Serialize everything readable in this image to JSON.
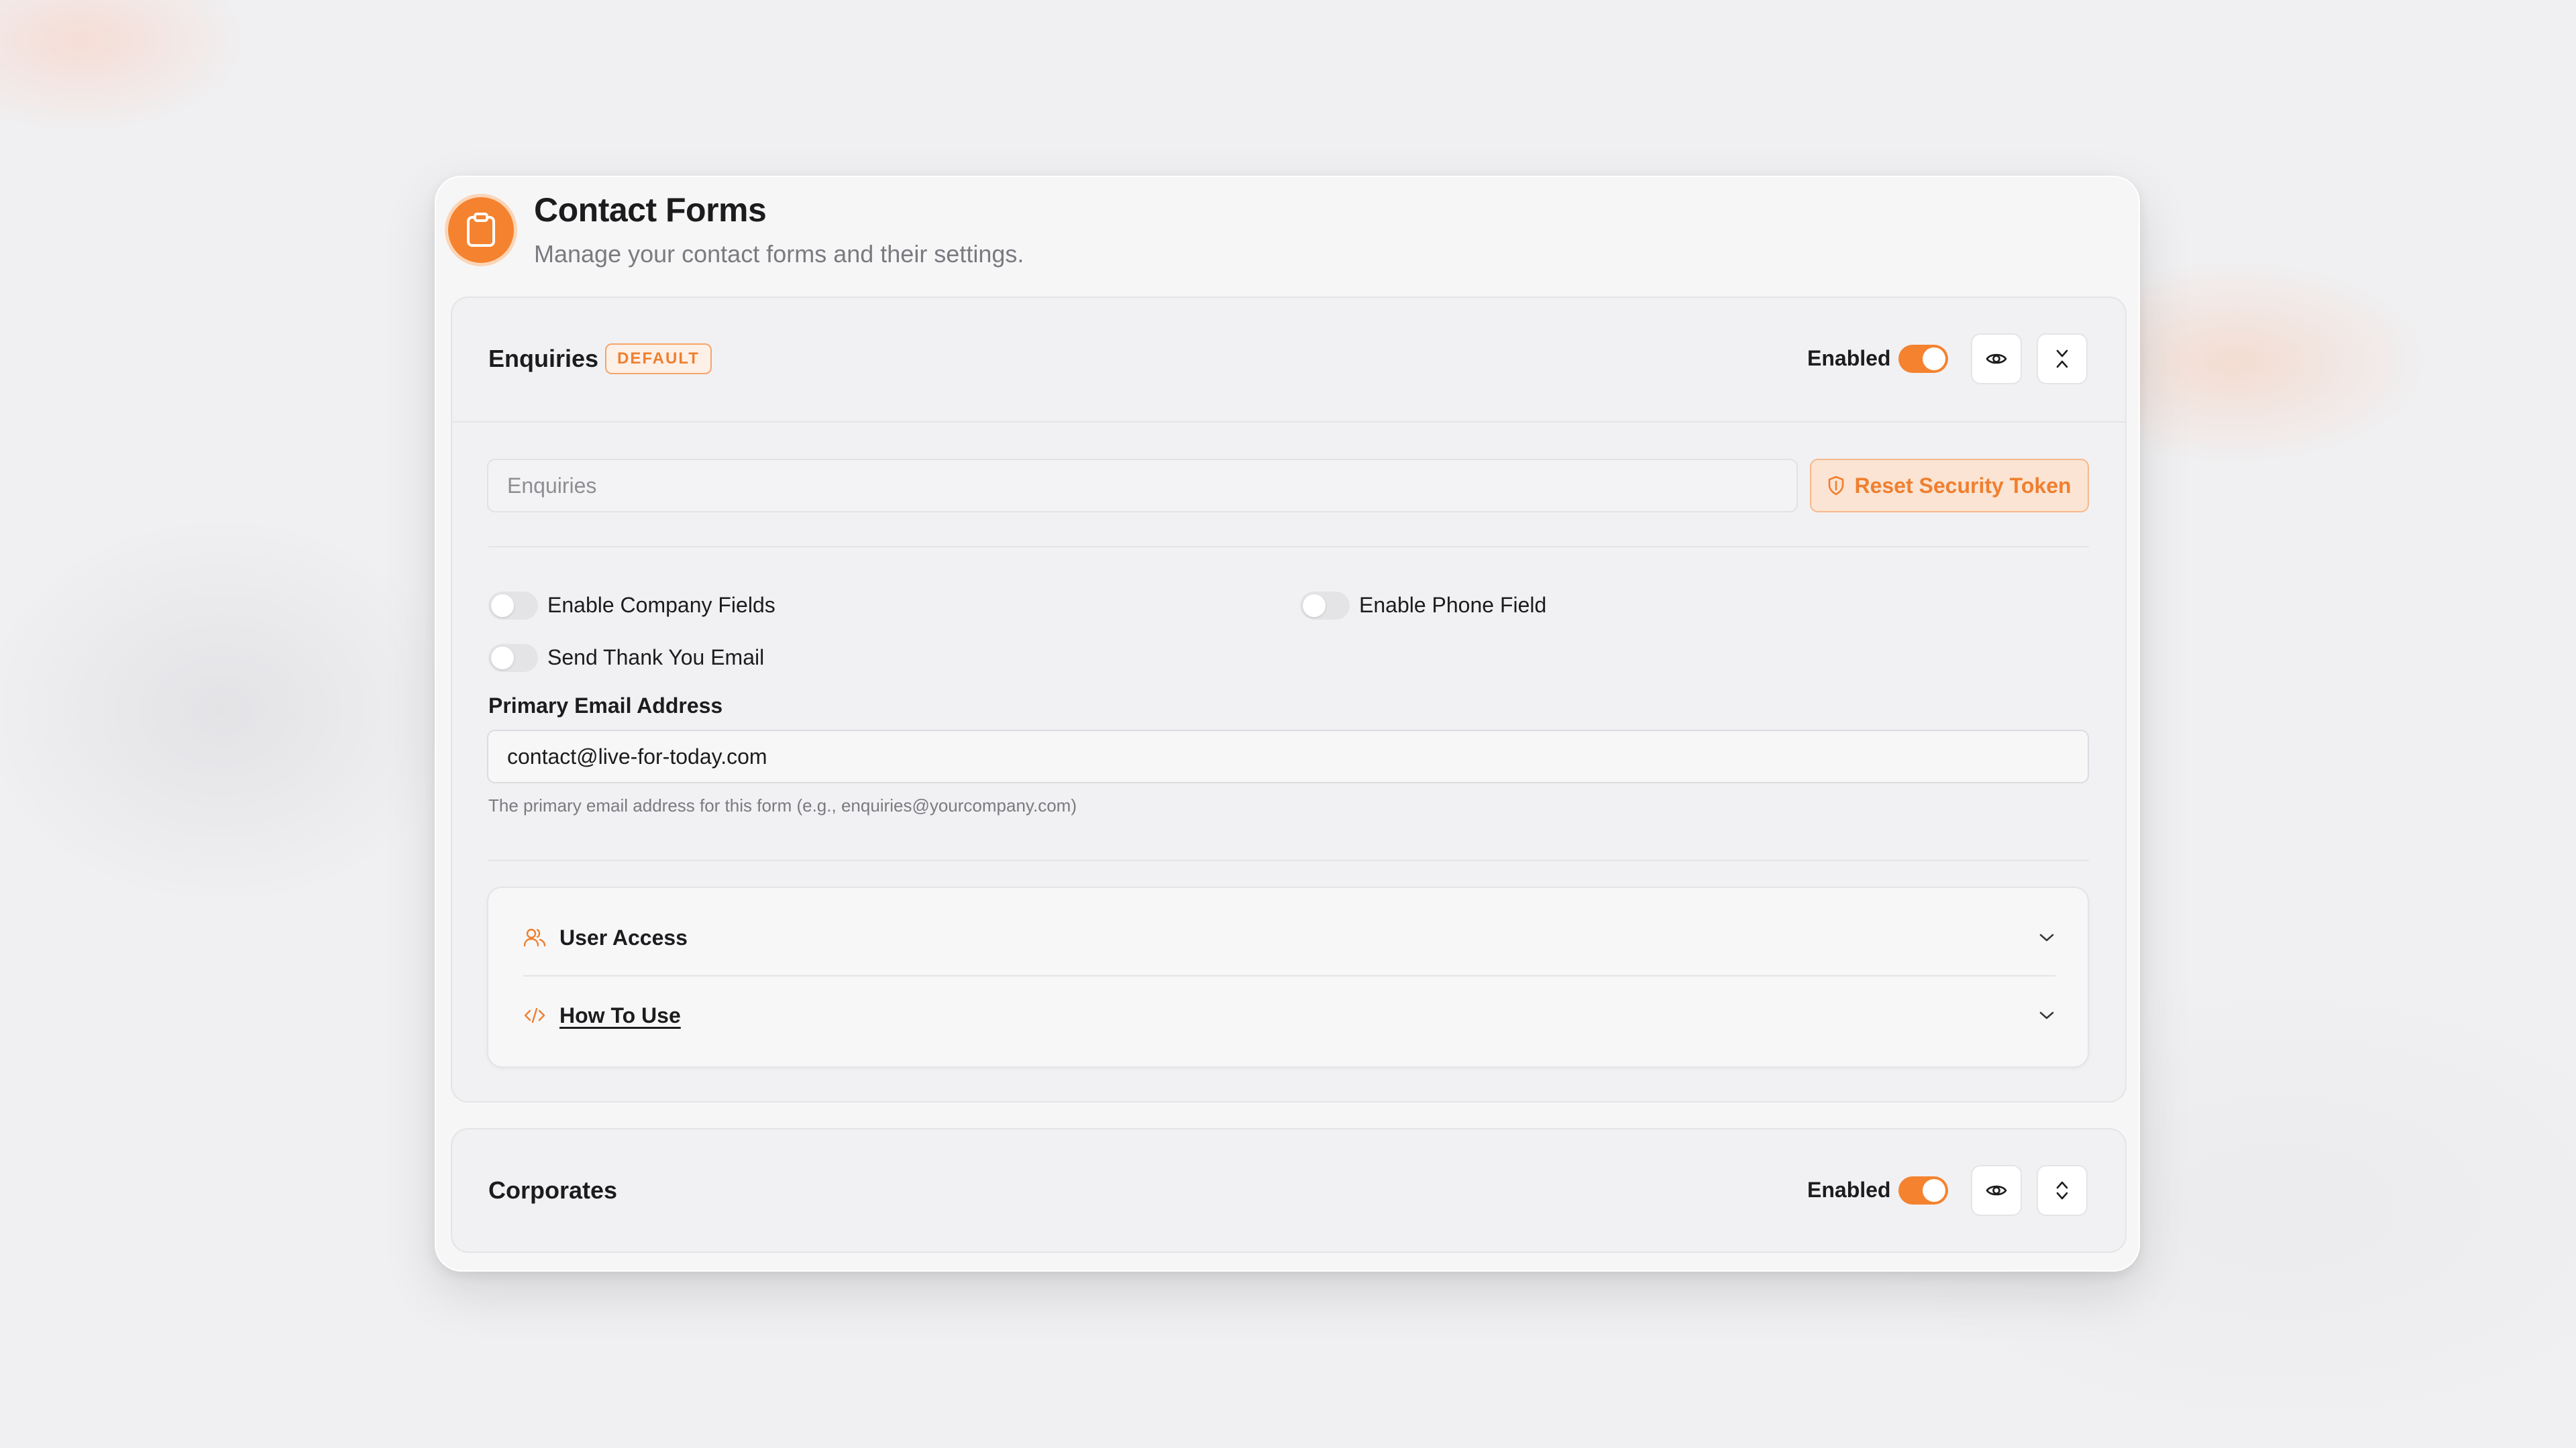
{
  "page": {
    "title": "Contact Forms",
    "subtitle": "Manage your contact forms and their settings.",
    "logo_icon": "clipboard-icon",
    "accent_color": "#f5822e"
  },
  "forms": [
    {
      "name": "Enquiries",
      "badge": "DEFAULT",
      "enabled_label": "Enabled",
      "enabled": true,
      "expanded": true,
      "name_placeholder": "Enquiries",
      "reset_token_label": "Reset Security Token",
      "options": {
        "company_fields": {
          "label": "Enable Company Fields",
          "on": false
        },
        "phone_field": {
          "label": "Enable Phone Field",
          "on": false
        },
        "thank_you_email": {
          "label": "Send Thank You Email",
          "on": false
        }
      },
      "primary_email": {
        "label": "Primary Email Address",
        "value": "contact@live-for-today.com",
        "helper": "The primary email address for this form (e.g., enquiries@yourcompany.com)"
      },
      "sections": [
        {
          "label": "User Access",
          "icon": "users-icon"
        },
        {
          "label": "How To Use",
          "icon": "code-icon"
        }
      ]
    },
    {
      "name": "Corporates",
      "enabled_label": "Enabled",
      "enabled": true,
      "expanded": false
    }
  ]
}
